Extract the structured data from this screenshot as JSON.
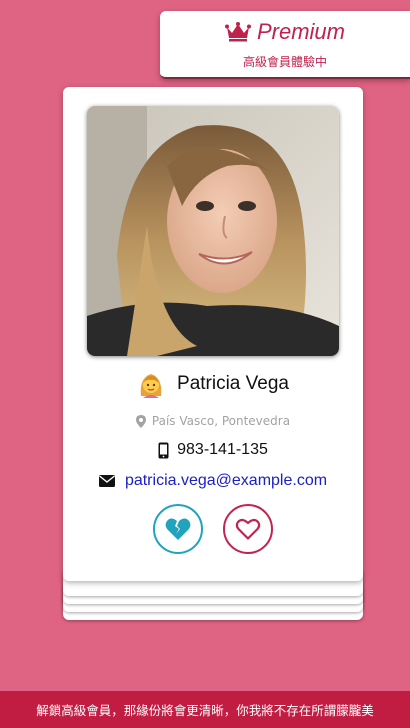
{
  "premium": {
    "title": "Premium",
    "subtitle": "高級會員體驗中",
    "icon": "crown-icon",
    "color": "#c2204d"
  },
  "profile": {
    "name": "Patricia Vega",
    "name_icon": "woman-emoji-icon",
    "location": "País Vasco, Pontevedra",
    "phone": "983-141-135",
    "email": "patricia.vega@example.com"
  },
  "actions": {
    "pass_icon": "broken-heart-icon",
    "like_icon": "heart-icon",
    "pass_color": "#20a3bd",
    "like_color": "#c2244e"
  },
  "footer": {
    "text": "解鎖高級會員，那緣份將會更清晰，你我將不存在所謂朦朧美"
  },
  "colors": {
    "background": "#df6382",
    "accent": "#c11d43"
  }
}
